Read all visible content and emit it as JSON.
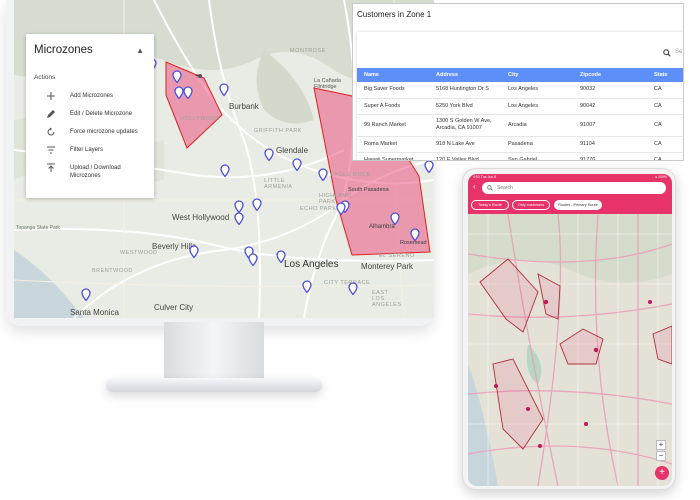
{
  "panel": {
    "title": "Microzones",
    "actions_label": "Actions",
    "items": [
      {
        "label": "Add Microzones",
        "icon": "plus-icon"
      },
      {
        "label": "Edit / Delete Microzone",
        "icon": "pencil-icon"
      },
      {
        "label": "Force microzone updates",
        "icon": "refresh-icon"
      },
      {
        "label": "Filter Layers",
        "icon": "filter-icon"
      },
      {
        "label": "Upload / Download Microzones",
        "icon": "upload-icon"
      }
    ]
  },
  "map": {
    "labels": {
      "la_canada": "La Cañada\nFlintridge",
      "burbank": "Burbank",
      "glendale": "Glendale",
      "south_pasadena": "South Pasadena",
      "alhambra": "Alhambra",
      "rosemead": "Rosemead",
      "west_hollywood": "West Hollywood",
      "beverly_hills": "Beverly Hills",
      "los_angeles": "Los Angeles",
      "monterey_park": "Monterey Park",
      "santa_monica": "Santa Monica",
      "culver_city": "Culver City",
      "brentwood": "BRENTWOOD",
      "westwood": "WESTWOOD",
      "topanga": "Topanga State Park",
      "hollywood": "HOLLYWOOD",
      "echo_park": "ECHO PARK",
      "little_armenia": "LITTLE\nARMENIA",
      "east_la": "EAST\nLOS\nANGELES",
      "el_sereno": "EL SERENO",
      "city_terrace": "CITY TERRACE",
      "highland_park": "HIGHLAND\nPARK",
      "griffith": "GRIFFITH PARK",
      "montrose": "MONTROSE",
      "eagle_rock": "EAGLE ROCK"
    },
    "zone_color": "#e8336a"
  },
  "customers": {
    "title": "Customers in Zone 1",
    "search_placeholder": "Se",
    "columns": [
      "Name",
      "Address",
      "City",
      "Zipcode",
      "State"
    ],
    "rows": [
      [
        "Big Saver Foods",
        "5168 Huntington Dr S",
        "Los Angeles",
        "90032",
        "CA"
      ],
      [
        "Super A Foods",
        "5250 York Blvd",
        "Los Angeles",
        "90042",
        "CA"
      ],
      [
        "99 Ranch Market",
        "1300 S Golden W Ave, Arcadia, CA 91007",
        "Arcadia",
        "91007",
        "CA"
      ],
      [
        "Roma Market",
        "918 N Lake Ave",
        "Pasadena",
        "91104",
        "CA"
      ],
      [
        "Hawaii Supermarket",
        "120 E Valley Blvd",
        "San Gabriel",
        "91776",
        "CA"
      ]
    ],
    "header_color": "#5e8ef7"
  },
  "tablet": {
    "status_left": "4:52  Tue Jun 8",
    "status_right": "● 100%",
    "search_placeholder": "Search",
    "chips": [
      "Today's Route",
      "Only customers",
      "Routes - Primary Route"
    ],
    "accent": "#e8336a",
    "zoom_in": "+",
    "zoom_out": "−",
    "fab": "+"
  }
}
